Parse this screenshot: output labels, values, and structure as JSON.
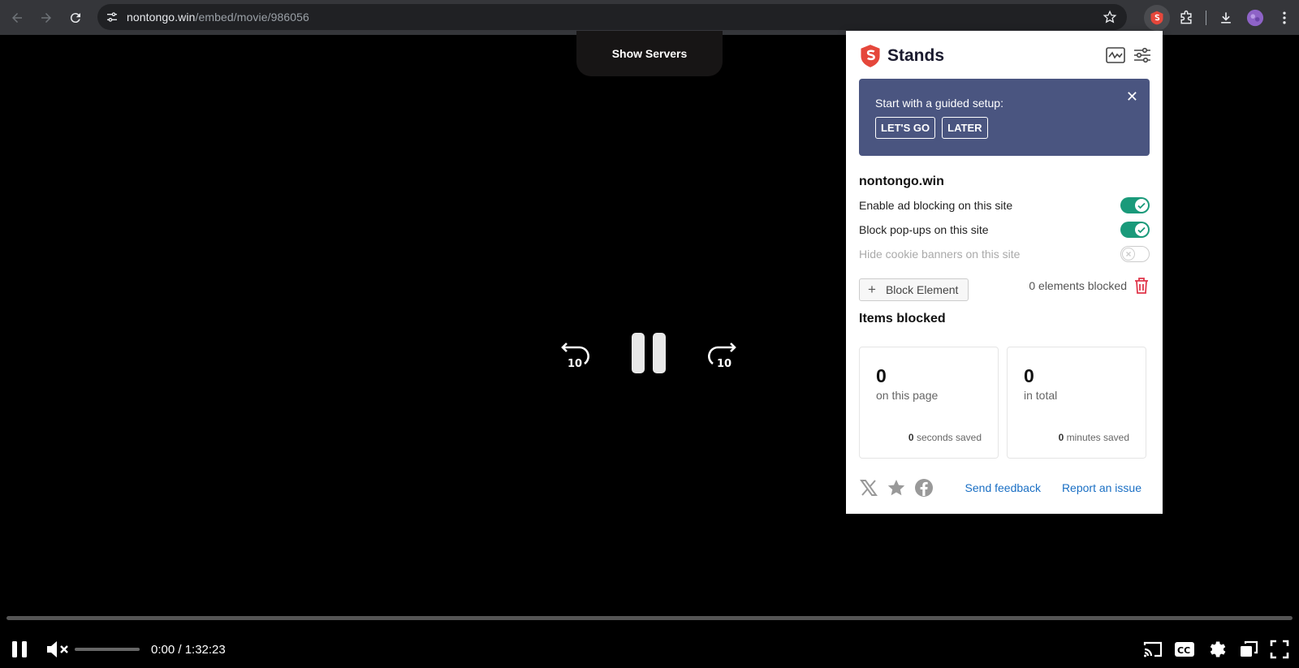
{
  "browser": {
    "url_host": "nontongo.win",
    "url_path": "/embed/movie/986056"
  },
  "player": {
    "show_servers_label": "Show Servers",
    "rewind_label": "10",
    "forward_label": "10",
    "time_display": "0:00 / 1:32:23",
    "progress_fraction": 0
  },
  "popup": {
    "brand": "Stands",
    "guide": {
      "text": "Start with a guided setup:",
      "close": "✕",
      "lets_go": "LET'S GO",
      "later": "LATER"
    },
    "site_name": "nontongo.win",
    "toggles": [
      {
        "label": "Enable ad blocking on this site",
        "state": "on"
      },
      {
        "label": "Block pop-ups on this site",
        "state": "on"
      },
      {
        "label": "Hide cookie banners on this site",
        "state": "off"
      }
    ],
    "block_element_label": "Block Element",
    "elements_blocked": "0 elements blocked",
    "items_blocked_title": "Items blocked",
    "stats": [
      {
        "value": "0",
        "label": "on this page",
        "saved_value": "0",
        "saved_label": "seconds saved"
      },
      {
        "value": "0",
        "label": "in total",
        "saved_value": "0",
        "saved_label": "minutes saved"
      }
    ],
    "footer": {
      "send_feedback": "Send feedback",
      "report_issue": "Report an issue"
    },
    "colors": {
      "accent_toggle": "#1a9a7a",
      "guide_bg": "#4a5580",
      "link": "#1a6fc4",
      "brand_red": "#e5473b"
    }
  }
}
